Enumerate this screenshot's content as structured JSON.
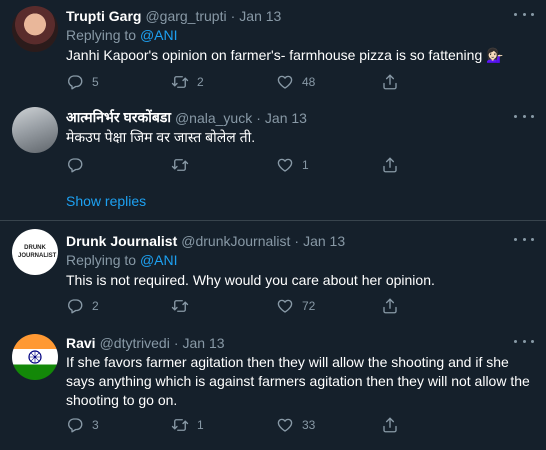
{
  "tweets": [
    {
      "name": "Trupti Garg",
      "handle": "@garg_trupti",
      "date": "Jan 13",
      "replying_prefix": "Replying to ",
      "replying_to": "@ANI",
      "text": "Janhi Kapoor's opinion on farmer's- farmhouse pizza is so fattening 💁🏻‍♀️",
      "replies": "5",
      "retweets": "2",
      "likes": "48"
    },
    {
      "name": "आत्मनिर्भर घरकोंबडा",
      "handle": "@nala_yuck",
      "date": "Jan 13",
      "text": "मेकउप पेक्षा जिम वर जास्त बोलेल ती.",
      "replies": "",
      "retweets": "",
      "likes": "1"
    },
    {
      "name": "Drunk Journalist",
      "handle": "@drunkJournalist",
      "date": "Jan 13",
      "replying_prefix": "Replying to ",
      "replying_to": "@ANI",
      "avatar_logo": "DRUNK JOURNALIST",
      "text": "This is not required. Why would you care about her opinion.",
      "replies": "2",
      "retweets": "",
      "likes": "72"
    },
    {
      "name": "Ravi",
      "handle": "@dtytrivedi",
      "date": "Jan 13",
      "text": "If she favors farmer agitation then they will allow the shooting and if she says anything which is against farmers agitation then they will not allow the shooting to go on.",
      "replies": "3",
      "retweets": "1",
      "likes": "33"
    }
  ],
  "show_replies_label": "Show replies",
  "colors": {
    "background": "#15202b",
    "accent": "#1da1f2",
    "muted": "#8899a6",
    "divider": "#38444d"
  }
}
